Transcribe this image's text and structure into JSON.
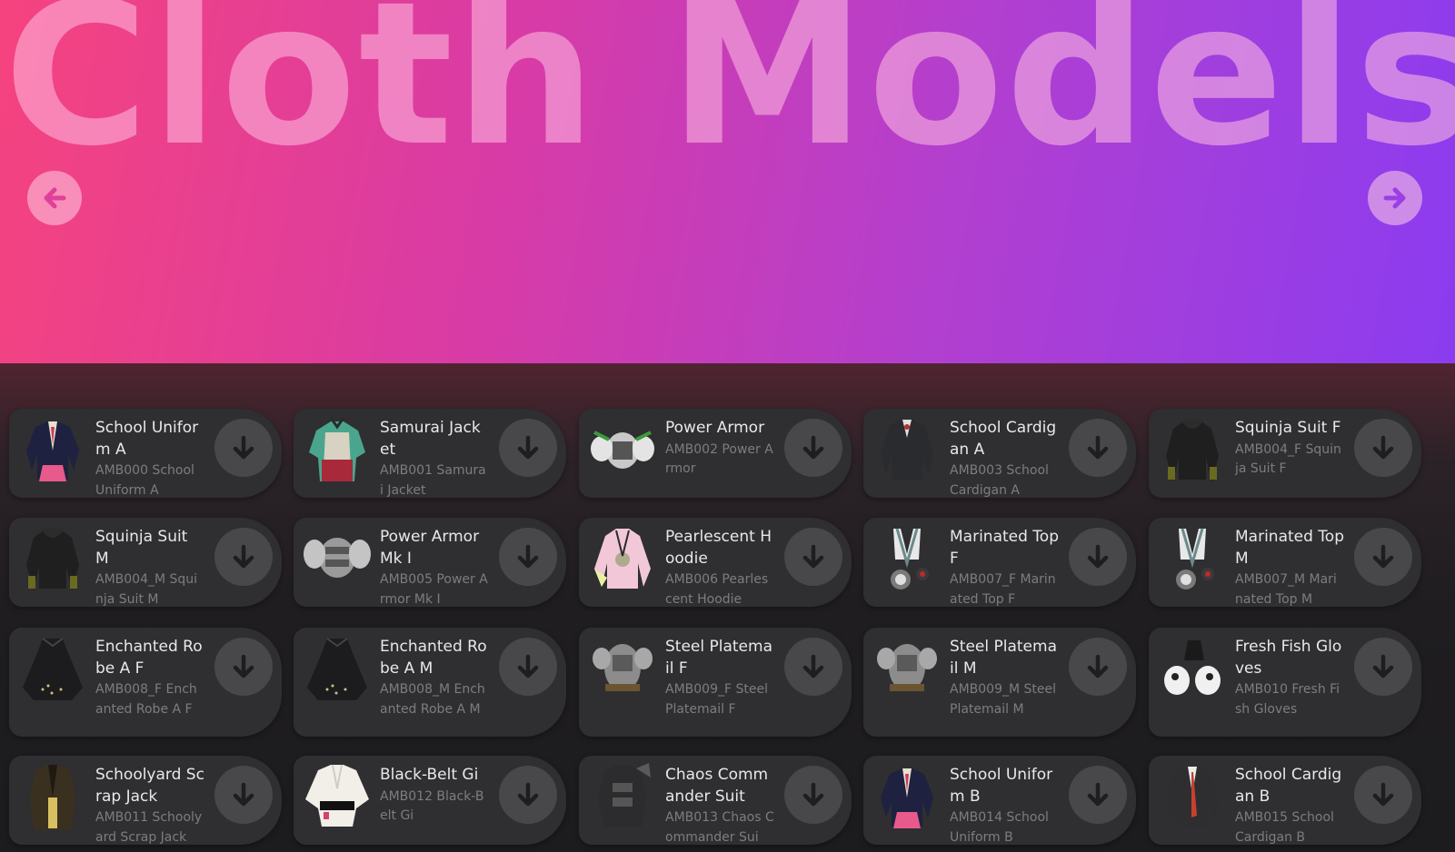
{
  "header": {
    "title": "Cloth Models",
    "prev_icon": "arrow-left-icon",
    "next_icon": "arrow-right-icon"
  },
  "colors": {
    "hero_gradient_start": "#f5437e",
    "hero_gradient_end": "#8b3cf0",
    "card_bg": "#2f2e31",
    "download_button_bg": "#48474a"
  },
  "models": [
    {
      "name": "School Uniform A",
      "subtitle": "AMB000 School Uniform A",
      "thumb": "school-uniform-jacket"
    },
    {
      "name": "Samurai Jacket",
      "subtitle": "AMB001 Samurai Jacket",
      "thumb": "samurai-armor-jacket"
    },
    {
      "name": "Power Armor",
      "subtitle": "AMB002 Power Armor",
      "thumb": "power-armor"
    },
    {
      "name": "School Cardigan A",
      "subtitle": "AMB003 School Cardigan A",
      "thumb": "school-cardigan"
    },
    {
      "name": "Squinja Suit F",
      "subtitle": "AMB004_F Squinja Suit F",
      "thumb": "squinja-suit"
    },
    {
      "name": "Squinja Suit M",
      "subtitle": "AMB004_M Squinja Suit M",
      "thumb": "squinja-suit"
    },
    {
      "name": "Power Armor Mk I",
      "subtitle": "AMB005 Power Armor Mk I",
      "thumb": "power-armor-mk1"
    },
    {
      "name": "Pearlescent Hoodie",
      "subtitle": "AMB006 Pearlescent Hoodie",
      "thumb": "pearlescent-hoodie"
    },
    {
      "name": "Marinated Top F",
      "subtitle": "AMB007_F Marinated Top F",
      "thumb": "marinated-top"
    },
    {
      "name": "Marinated Top M",
      "subtitle": "AMB007_M Marinated Top M",
      "thumb": "marinated-top"
    },
    {
      "name": "Enchanted Robe A F",
      "subtitle": "AMB008_F Enchanted Robe A F",
      "thumb": "enchanted-robe"
    },
    {
      "name": "Enchanted Robe A M",
      "subtitle": "AMB008_M Enchanted Robe A M",
      "thumb": "enchanted-robe"
    },
    {
      "name": "Steel Platemail F",
      "subtitle": "AMB009_F Steel Platemail F",
      "thumb": "steel-platemail"
    },
    {
      "name": "Steel Platemail M",
      "subtitle": "AMB009_M Steel Platemail M",
      "thumb": "steel-platemail"
    },
    {
      "name": "Fresh Fish Gloves",
      "subtitle": "AMB010 Fresh Fish Gloves",
      "thumb": "fresh-fish-gloves"
    },
    {
      "name": "Schoolyard Scrap Jack",
      "subtitle": "AMB011 Schoolyard Scrap Jack",
      "thumb": "schoolyard-jacket"
    },
    {
      "name": "Black-Belt Gi",
      "subtitle": "AMB012 Black-Belt Gi",
      "thumb": "black-belt-gi"
    },
    {
      "name": "Chaos Commander Suit",
      "subtitle": "AMB013 Chaos Commander Sui",
      "thumb": "chaos-commander-suit"
    },
    {
      "name": "School Uniform B",
      "subtitle": "AMB014 School Uniform B",
      "thumb": "school-uniform-jacket"
    },
    {
      "name": "School Cardigan B",
      "subtitle": "AMB015 School Cardigan B",
      "thumb": "school-cardigan-b"
    }
  ],
  "download_icon": "arrow-down-icon"
}
